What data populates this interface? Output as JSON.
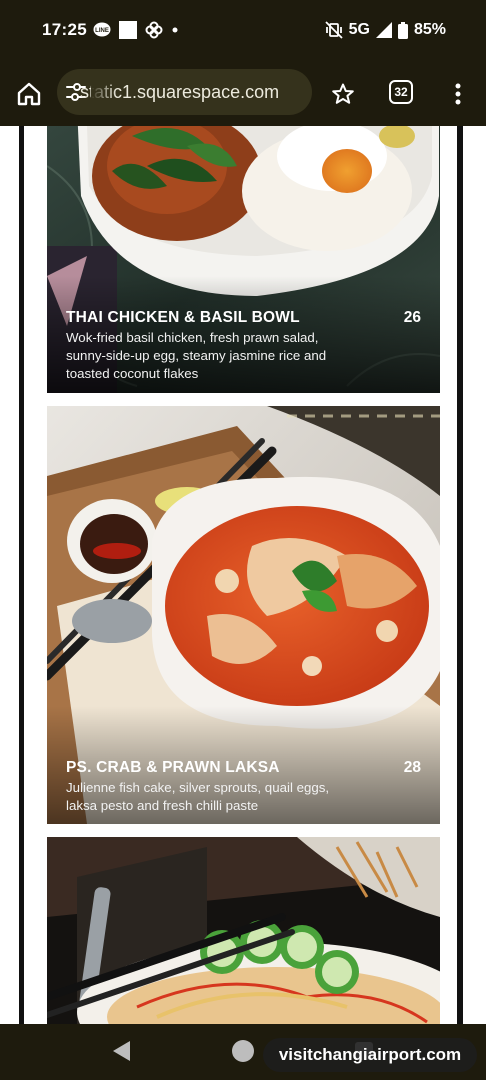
{
  "status_bar": {
    "time": "17:25",
    "network": "5G",
    "battery": "85%"
  },
  "browser": {
    "url": "static1.squarespace.com",
    "tab_count": "32"
  },
  "menu_items": [
    {
      "title": "THAI CHICKEN & BASIL BOWL",
      "price": "26",
      "description": "Wok-fried basil chicken, fresh prawn salad, sunny-side-up egg, steamy jasmine rice and toasted coconut flakes"
    },
    {
      "title": "PS. CRAB & PRAWN LAKSA",
      "price": "28",
      "description": "Julienne fish cake, silver sprouts, quail eggs, laksa pesto and fresh chilli paste"
    }
  ],
  "watermark": "visitchangiairport.com",
  "colors": {
    "chrome_bg": "#1e1b0d",
    "url_pill": "#35321c",
    "laksa_broth": "#d8471e",
    "marble_green": "#2c3b34"
  }
}
